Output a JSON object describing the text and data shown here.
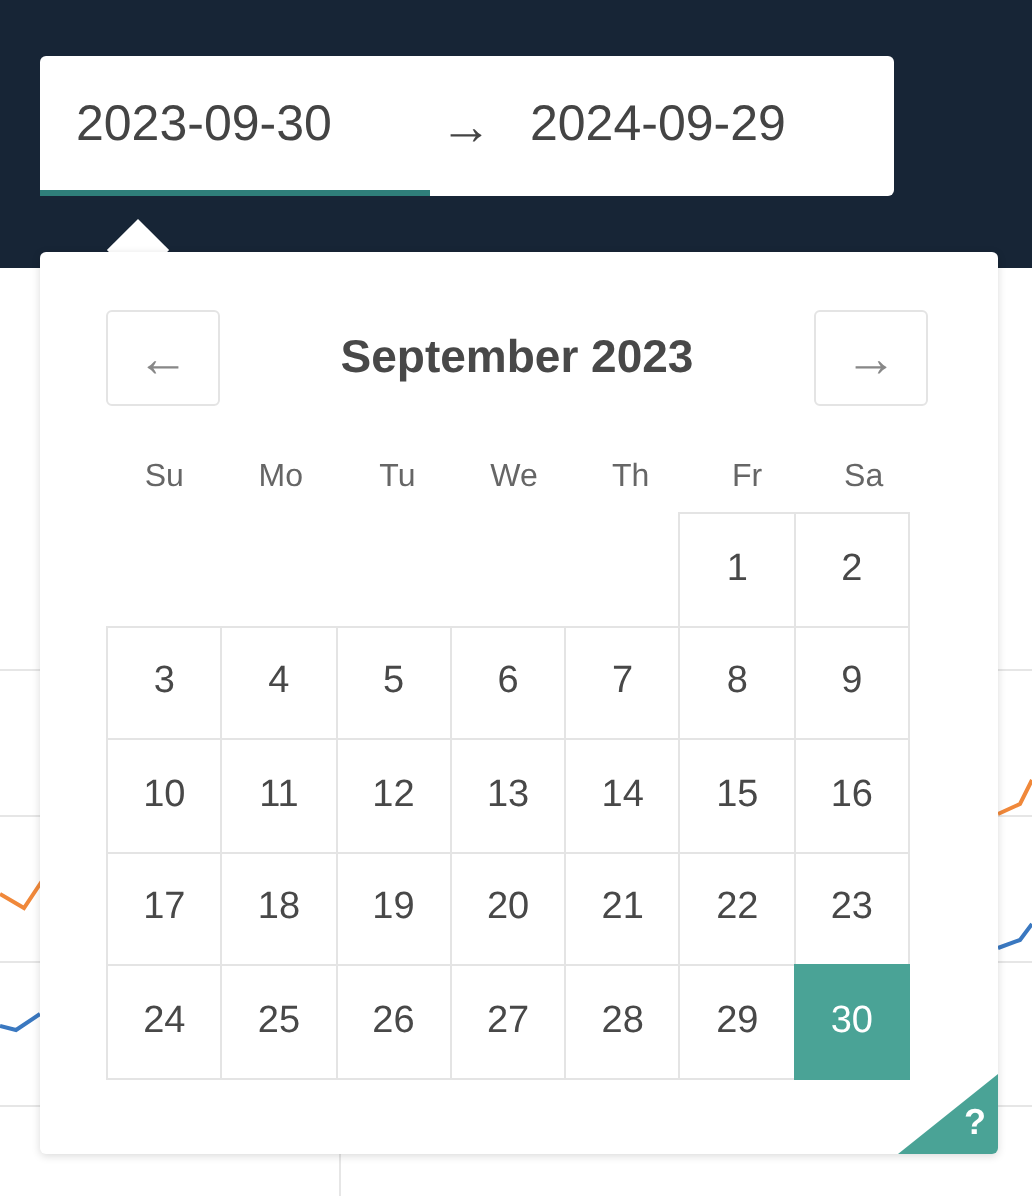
{
  "range_input": {
    "start": {
      "value": "2023-09-30",
      "selected": true
    },
    "separator": "→",
    "end": {
      "value": "2024-09-29",
      "selected": false
    }
  },
  "calendar": {
    "prev": "←",
    "next": "→",
    "title": "September 2023",
    "weekdays": [
      "Su",
      "Mo",
      "Tu",
      "We",
      "Th",
      "Fr",
      "Sa"
    ],
    "weeks": [
      {
        "days": [
          {
            "label": "1",
            "selected": false
          },
          {
            "label": "2",
            "selected": false
          }
        ]
      },
      {
        "days": [
          {
            "label": "3",
            "selected": false
          },
          {
            "label": "4",
            "selected": false
          },
          {
            "label": "5",
            "selected": false
          },
          {
            "label": "6",
            "selected": false
          },
          {
            "label": "7",
            "selected": false
          },
          {
            "label": "8",
            "selected": false
          },
          {
            "label": "9",
            "selected": false
          }
        ]
      },
      {
        "days": [
          {
            "label": "10",
            "selected": false
          },
          {
            "label": "11",
            "selected": false
          },
          {
            "label": "12",
            "selected": false
          },
          {
            "label": "13",
            "selected": false
          },
          {
            "label": "14",
            "selected": false
          },
          {
            "label": "15",
            "selected": false
          },
          {
            "label": "16",
            "selected": false
          }
        ]
      },
      {
        "days": [
          {
            "label": "17",
            "selected": false
          },
          {
            "label": "18",
            "selected": false
          },
          {
            "label": "19",
            "selected": false
          },
          {
            "label": "20",
            "selected": false
          },
          {
            "label": "21",
            "selected": false
          },
          {
            "label": "22",
            "selected": false
          },
          {
            "label": "23",
            "selected": false
          }
        ]
      },
      {
        "days": [
          {
            "label": "24",
            "selected": false
          },
          {
            "label": "25",
            "selected": false
          },
          {
            "label": "26",
            "selected": false
          },
          {
            "label": "27",
            "selected": false
          },
          {
            "label": "28",
            "selected": false
          },
          {
            "label": "29",
            "selected": false
          },
          {
            "label": "30",
            "selected": true
          }
        ]
      }
    ],
    "help": "?"
  }
}
